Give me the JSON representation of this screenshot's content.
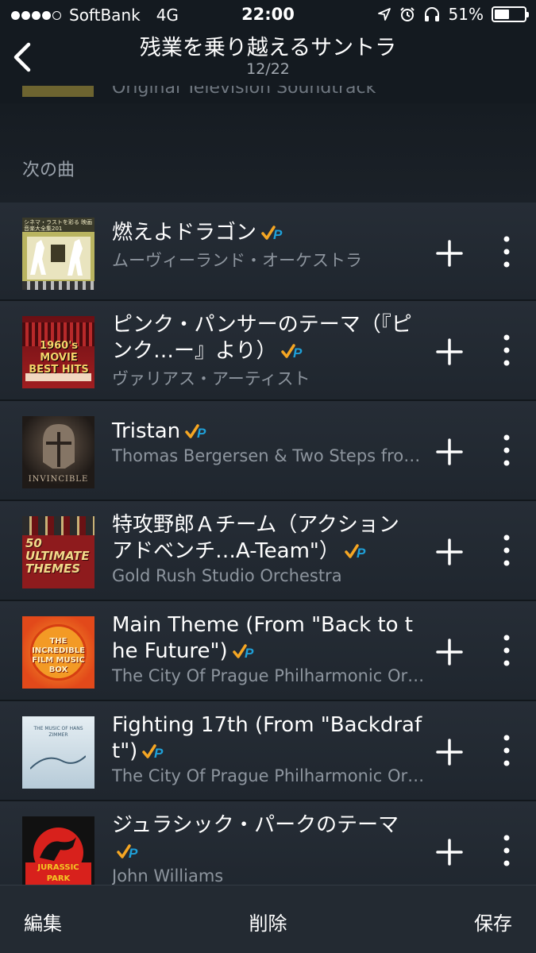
{
  "status": {
    "carrier": "SoftBank",
    "network": "4G",
    "time": "22:00",
    "battery_text": "51%",
    "battery_level": 0.51
  },
  "header": {
    "title": "残業を乗り越えるサントラ",
    "subtitle": "12/22"
  },
  "previous": {
    "peek_text": "Original Television Soundtrack"
  },
  "queue": {
    "label": "次の曲"
  },
  "tracks": [
    {
      "title": "燃えよドラゴン",
      "artist": "ムーヴィーランド・オーケストラ",
      "art": {
        "bg": "#b5b25d",
        "accent": "#f2efe0",
        "text": "シネマ・ラストを彩る 映画音楽大全集201"
      }
    },
    {
      "title": "ピンク・パンサーのテーマ（『ピンク…ー』より）",
      "artist": "ヴァリアス・アーティスト",
      "art": {
        "bg": "#7b1418",
        "accent": "#f4d46a",
        "text": "1960's MOVIE BEST HITS"
      }
    },
    {
      "title": "Tristan",
      "artist": "Thomas Bergersen & Two Steps fro…",
      "art": {
        "bg": "#2a2420",
        "accent": "#8a7c6c",
        "text": "INVINCIBLE"
      }
    },
    {
      "title": "特攻野郎Ａチーム（アクション アドベンチ…A-Team\"）",
      "artist": "Gold Rush Studio Orchestra",
      "art": {
        "bg": "#8e1b1d",
        "accent": "#f1d98a",
        "text": "50 ULTIMATE THEMES"
      }
    },
    {
      "title": "Main Theme (From \"Back to the Future\")",
      "artist": "The City Of Prague Philharmonic Or…",
      "art": {
        "bg": "#e85b1e",
        "accent": "#f9c33b",
        "text": "THE INCREDIBLE FILM MUSIC BOX"
      }
    },
    {
      "title": "Fighting 17th (From \"Backdraft\")",
      "artist": "The City Of Prague Philharmonic Or…",
      "art": {
        "bg": "#cfdde6",
        "accent": "#3c5a70",
        "text": "THE MUSIC OF HANS ZIMMER"
      }
    },
    {
      "title": "ジュラシック・パークのテーマ",
      "artist": "John Williams",
      "art": {
        "bg": "#111111",
        "accent": "#d8211c",
        "text": "JURASSIC PARK"
      }
    }
  ],
  "toolbar": {
    "edit": "編集",
    "delete": "削除",
    "save": "保存"
  },
  "colors": {
    "background": "#1c2229",
    "prime_orange": "#f5a623",
    "prime_blue": "#1fa0d8",
    "secondary_text": "#8d959e"
  }
}
